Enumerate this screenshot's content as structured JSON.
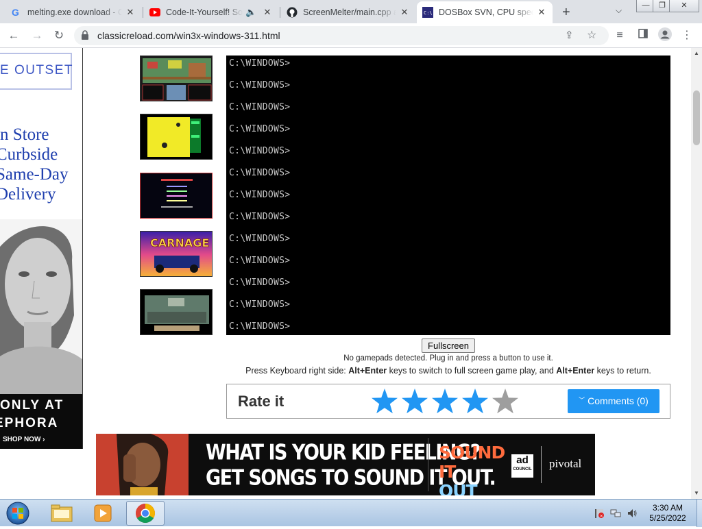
{
  "browser": {
    "tabs": [
      {
        "title": "melting.exe download - C",
        "icon": "google-icon",
        "active": false
      },
      {
        "title": "Code-It-Yourself! Sou",
        "icon": "youtube-icon",
        "active": false
      },
      {
        "title": "ScreenMelter/main.cpp a",
        "icon": "github-icon",
        "active": false
      },
      {
        "title": "DOSBox SVN, CPU speed",
        "icon": "dosbox-icon",
        "active": true
      }
    ],
    "new_tab_label": "+",
    "url": "classicreload.com/win3x-windows-311.html"
  },
  "ads": {
    "left": {
      "outset": "E OUTSET",
      "store_lines": [
        "n Store",
        "Curbside",
        "Same-Day",
        "Delivery"
      ],
      "only_at": "ONLY AT",
      "brand": "EPHORA",
      "cta": "SHOP NOW ›"
    },
    "bottom": {
      "headline_1": "WHAT IS YOUR KID FEELING?",
      "headline_2": "GET SONGS TO SOUND IT OUT.",
      "sound": "SOUND IT",
      "out": "OUT",
      "ad": "ad",
      "council": "COUNCIL",
      "pivotal": "pivotal"
    }
  },
  "emulator": {
    "lines": [
      "C:\\WINDOWS>",
      "C:\\WINDOWS>",
      "C:\\WINDOWS>",
      "C:\\WINDOWS>",
      "C:\\WINDOWS>",
      "C:\\WINDOWS>",
      "C:\\WINDOWS>",
      "C:\\WINDOWS>",
      "C:\\WINDOWS>",
      "C:\\WINDOWS>",
      "C:\\WINDOWS>",
      "C:\\WINDOWS>",
      "C:\\WINDOWS>"
    ],
    "fullscreen_label": "Fullscreen",
    "gamepad_note": "No gamepads detected. Plug in and press a button to use it.",
    "kb_note_1": "Press Keyboard right side: ",
    "kb_key_1": "Alt+Enter",
    "kb_note_2": " keys to switch to full screen game play, and ",
    "kb_key_2": "Alt+Enter",
    "kb_note_3": " keys to return."
  },
  "rating": {
    "title": "Rate it",
    "stars_filled": 4,
    "stars_total": 5,
    "comments_label": "Comments (0)",
    "star_color": "#2196f3",
    "star_empty_color": "#9e9e9e"
  },
  "taskbar": {
    "time": "3:30 AM",
    "date": "5/25/2022"
  }
}
